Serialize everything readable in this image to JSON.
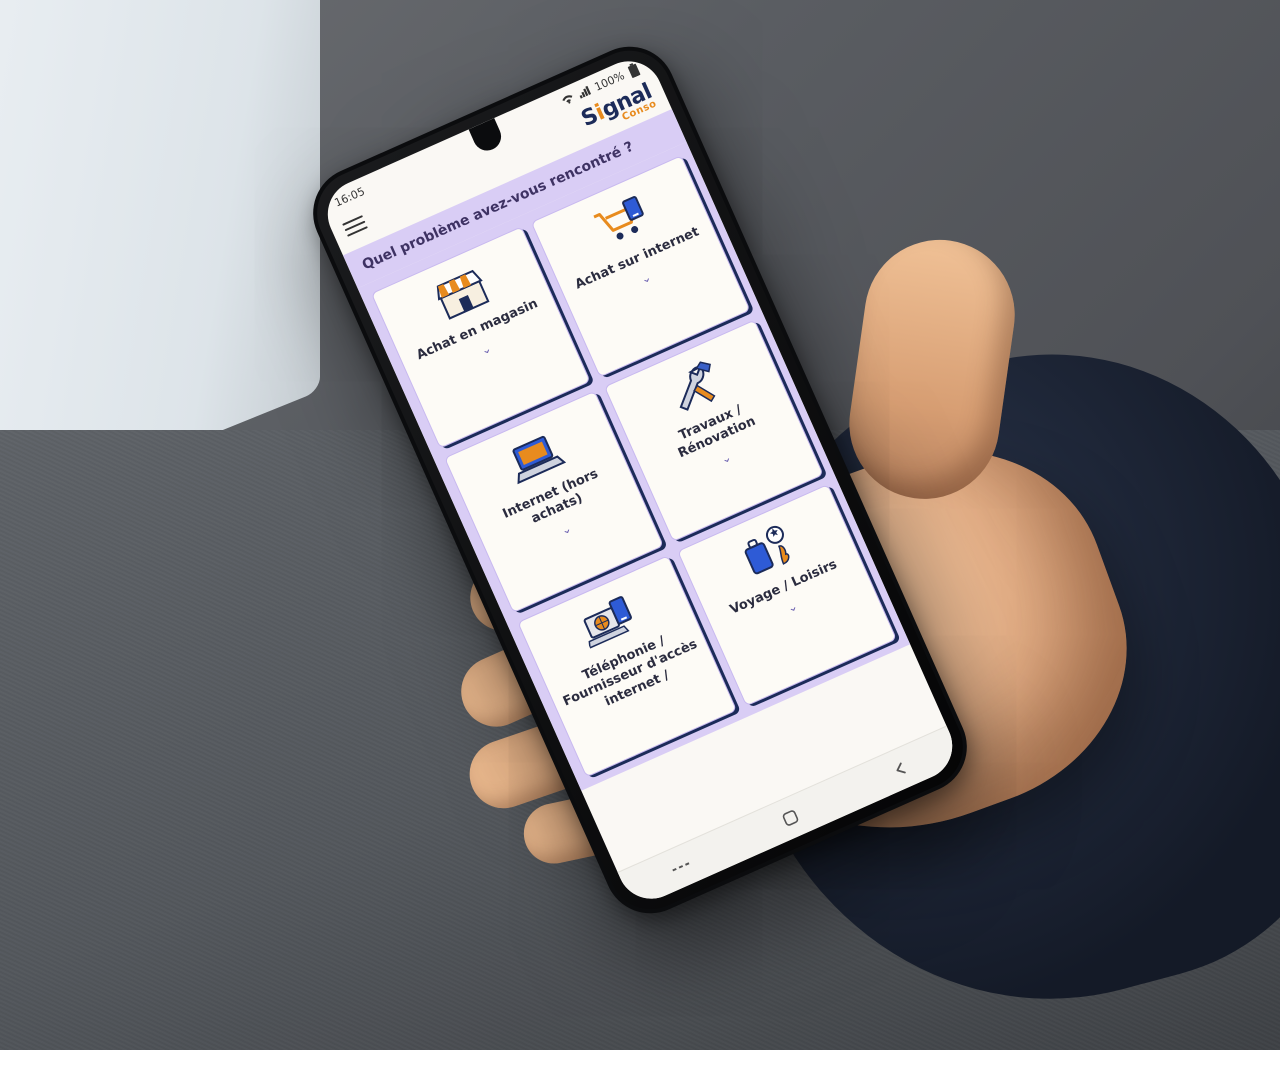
{
  "status": {
    "time": "16:05",
    "battery": "100%"
  },
  "app": {
    "logo_main": "Signal",
    "logo_sub": "Conso",
    "question": "Quel problème avez-vous rencontré ?"
  },
  "cards": [
    {
      "label": "Achat en magasin"
    },
    {
      "label": "Achat sur internet"
    },
    {
      "label": "Internet (hors achats)"
    },
    {
      "label": "Travaux / Rénovation"
    },
    {
      "label": "Téléphonie / Fournisseur d'accès internet /"
    },
    {
      "label": "Voyage / Loisirs"
    }
  ]
}
